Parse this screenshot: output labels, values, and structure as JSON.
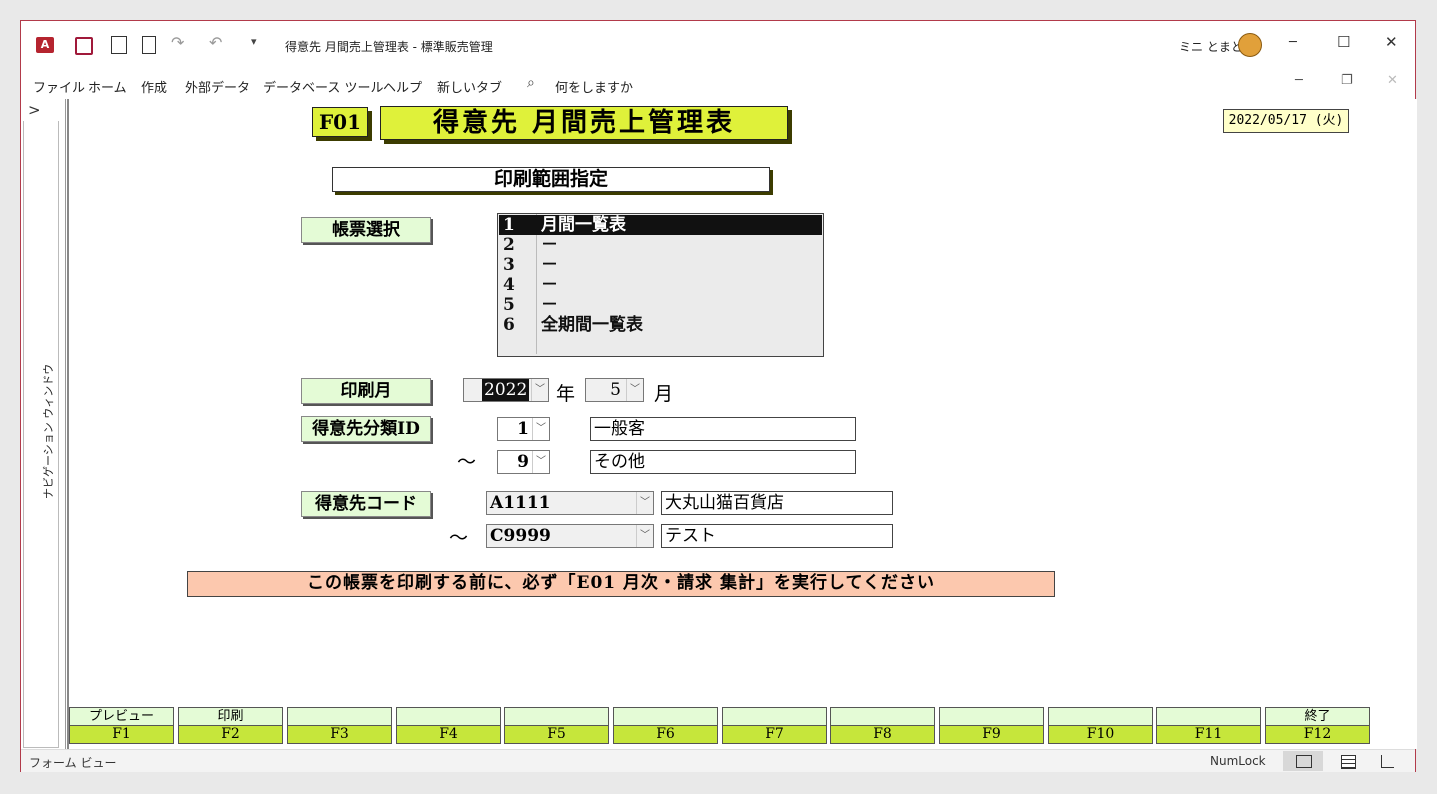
{
  "window": {
    "title": "得意先 月間売上管理表 - 標準販売管理",
    "user": "ミニ とまと",
    "minimize": "─",
    "maximize": "☐",
    "close": "✕"
  },
  "ribbon": {
    "tabs": [
      "ファイル",
      "ホーム",
      "作成",
      "外部データ",
      "データベース ツール",
      "ヘルプ",
      "新しいタブ"
    ],
    "search_placeholder": "何をしますか"
  },
  "nav_pane": {
    "label": "ナビゲーション ウィンドウ",
    "expand": ">"
  },
  "form": {
    "code": "F01",
    "title": "得意先 月間売上管理表",
    "date": "2022/05/17 (火)",
    "section": "印刷範囲指定",
    "report_select_label": "帳票選択",
    "report_list": [
      {
        "num": "1",
        "text": "月間一覧表",
        "selected": true
      },
      {
        "num": "2",
        "text": "－"
      },
      {
        "num": "3",
        "text": "－"
      },
      {
        "num": "4",
        "text": "－"
      },
      {
        "num": "5",
        "text": "－"
      },
      {
        "num": "6",
        "text": "全期間一覧表"
      }
    ],
    "print_month_label": "印刷月",
    "year_value": "2022",
    "year_unit": "年",
    "month_value": "5",
    "month_unit": "月",
    "category_label": "得意先分類ID",
    "category_from": "1",
    "category_from_name": "一般客",
    "tilde": "～",
    "category_to": "9",
    "category_to_name": "その他",
    "customer_code_label": "得意先コード",
    "customer_from": "A1111",
    "customer_from_name": "大丸山猫百貨店",
    "customer_to": "C9999",
    "customer_to_name": "テスト",
    "warning": "この帳票を印刷する前に、必ず「E01 月次・請求 集計」を実行してください"
  },
  "function_keys": [
    {
      "label": "プレビュー",
      "key": "F1"
    },
    {
      "label": "印刷",
      "key": "F2"
    },
    {
      "label": "",
      "key": "F3"
    },
    {
      "label": "",
      "key": "F4"
    },
    {
      "label": "",
      "key": "F5"
    },
    {
      "label": "",
      "key": "F6"
    },
    {
      "label": "",
      "key": "F7"
    },
    {
      "label": "",
      "key": "F8"
    },
    {
      "label": "",
      "key": "F9"
    },
    {
      "label": "",
      "key": "F10"
    },
    {
      "label": "",
      "key": "F11"
    },
    {
      "label": "終了",
      "key": "F12"
    }
  ],
  "status": {
    "view": "フォーム ビュー",
    "numlock": "NumLock"
  },
  "colors": {
    "header_yellow": "#dff13a",
    "label_green": "#e4fbd6",
    "fkey_green": "#c6e63b",
    "warning_pink": "#fcc8ae",
    "window_border": "#b23a4a"
  }
}
